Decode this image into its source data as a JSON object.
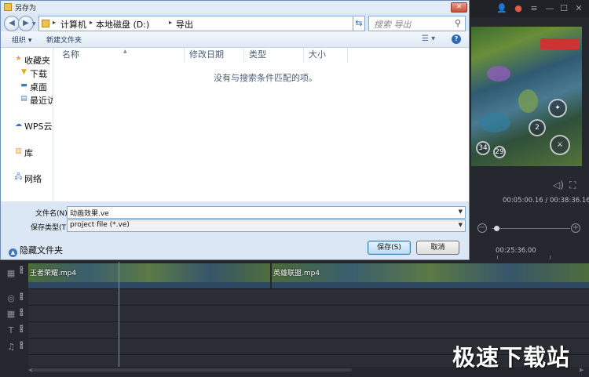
{
  "dialog": {
    "title": "另存为",
    "breadcrumb": [
      "计算机",
      "本地磁盘 (D:)",
      "导出"
    ],
    "search_placeholder": "搜索 导出",
    "toolbar": {
      "organize": "组织 ▾",
      "new_folder": "新建文件夹"
    },
    "nav": [
      {
        "icon": "star-icon",
        "label": "收藏夹"
      },
      {
        "icon": "download-folder-icon",
        "label": "下载"
      },
      {
        "icon": "desktop-icon",
        "label": "桌面"
      },
      {
        "icon": "recent-icon",
        "label": "最近访"
      },
      {
        "icon": "cloud-icon",
        "label": "WPS云"
      },
      {
        "icon": "library-icon",
        "label": "库"
      },
      {
        "icon": "network-icon",
        "label": "网络"
      }
    ],
    "columns": [
      "名称",
      "修改日期",
      "类型",
      "大小"
    ],
    "empty_message": "没有与搜索条件匹配的项。",
    "filename_label": "文件名(N):",
    "filename_value": "动画效果.ve",
    "filetype_label": "保存类型(T):",
    "filetype_value": "project file (*.ve)",
    "hide_folders": "隐藏文件夹",
    "save_button": "保存(S)",
    "cancel_button": "取消"
  },
  "editor": {
    "timecode": "00:05:00.16 / 00:38:36.16",
    "ruler_time": "00:25:36.00",
    "clips": [
      "王者荣耀.mp4",
      "英雄联盟.mp4"
    ],
    "watermark": "极速下载站"
  }
}
